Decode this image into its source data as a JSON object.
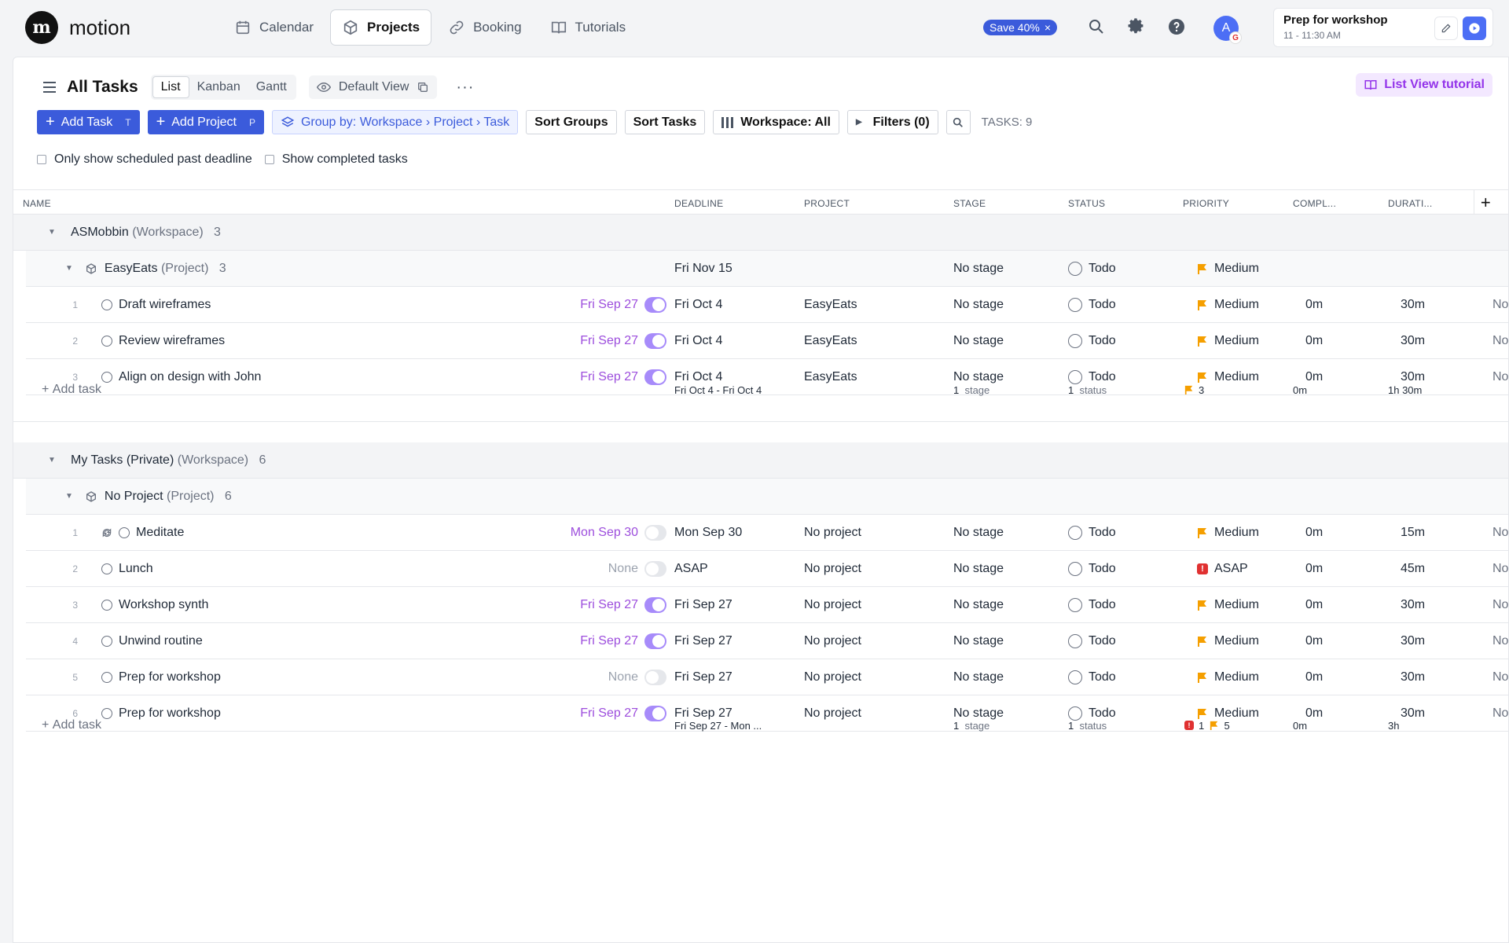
{
  "app": {
    "name": "motion",
    "logo_letter": "m"
  },
  "nav": {
    "items": [
      {
        "label": "Calendar",
        "icon": "calendar-icon"
      },
      {
        "label": "Projects",
        "icon": "cube-icon"
      },
      {
        "label": "Booking",
        "icon": "link-icon"
      },
      {
        "label": "Tutorials",
        "icon": "book-icon"
      }
    ],
    "active": "Projects"
  },
  "promo": {
    "label": "Save 40%",
    "close": "×"
  },
  "user": {
    "initial": "A",
    "badge": "G"
  },
  "event": {
    "title": "Prep for workshop",
    "time": "11 - 11:30 AM"
  },
  "page": {
    "title": "All Tasks",
    "views": [
      "List",
      "Kanban",
      "Gantt"
    ],
    "active_view": "List",
    "default_view": "Default View",
    "more": "···",
    "tutorial": "List View tutorial"
  },
  "toolbar": {
    "add_task": "Add Task",
    "add_task_key": "T",
    "add_project": "Add Project",
    "add_project_key": "P",
    "group_by": "Group by: Workspace › Project › Task",
    "sort_groups": "Sort Groups",
    "sort_tasks": "Sort Tasks",
    "workspace": "Workspace: All",
    "filters": "Filters (0)",
    "task_count": "TASKS: 9"
  },
  "options": {
    "past_deadline": "Only show scheduled past deadline",
    "show_completed": "Show completed tasks"
  },
  "columns": {
    "name": "NAME",
    "deadline": "DEADLINE",
    "project": "PROJECT",
    "stage": "STAGE",
    "status": "STATUS",
    "priority": "PRIORITY",
    "completed": "COMPL...",
    "duration": "DURATI...",
    "add": "+"
  },
  "groups": [
    {
      "workspace": "ASMobbin",
      "workspace_tag": "(Workspace)",
      "workspace_count": "3",
      "project": "EasyEats",
      "project_tag": "(Project)",
      "project_count": "3",
      "project_deadline": "Fri Nov 15",
      "project_stage": "No stage",
      "project_status": "Todo",
      "project_priority": "Medium",
      "tasks": [
        {
          "n": "1",
          "name": "Draft wireframes",
          "scheduled": "Fri Sep 27",
          "auto": true,
          "deadline": "Fri Oct 4",
          "project": "EasyEats",
          "stage": "No stage",
          "status": "Todo",
          "priority": "Medium",
          "completed": "0m",
          "duration": "30m",
          "extra": "No"
        },
        {
          "n": "2",
          "name": "Review wireframes",
          "scheduled": "Fri Sep 27",
          "auto": true,
          "deadline": "Fri Oct 4",
          "project": "EasyEats",
          "stage": "No stage",
          "status": "Todo",
          "priority": "Medium",
          "completed": "0m",
          "duration": "30m",
          "extra": "No"
        },
        {
          "n": "3",
          "name": "Align on design with John",
          "scheduled": "Fri Sep 27",
          "auto": true,
          "deadline": "Fri Oct 4",
          "project": "EasyEats",
          "stage": "No stage",
          "status": "Todo",
          "priority": "Medium",
          "completed": "0m",
          "duration": "30m",
          "extra": "No"
        }
      ],
      "summary": {
        "add": "Add task",
        "deadline": "Fri Oct 4 - Fri Oct 4",
        "stage_n": "1",
        "stage": "stage",
        "status_n": "1",
        "status": "status",
        "asap": "",
        "medium": "3",
        "completed": "0m",
        "duration": "1h 30m"
      }
    },
    {
      "workspace": "My Tasks (Private)",
      "workspace_tag": "(Workspace)",
      "workspace_count": "6",
      "project": "No Project",
      "project_tag": "(Project)",
      "project_count": "6",
      "tasks": [
        {
          "n": "1",
          "name": "Meditate",
          "recurring": true,
          "scheduled": "Mon Sep 30",
          "auto": false,
          "deadline": "Mon Sep 30",
          "project": "No project",
          "stage": "No stage",
          "status": "Todo",
          "priority": "Medium",
          "completed": "0m",
          "duration": "15m",
          "extra": "No"
        },
        {
          "n": "2",
          "name": "Lunch",
          "scheduled": "None",
          "auto": false,
          "deadline": "ASAP",
          "project": "No project",
          "stage": "No stage",
          "status": "Todo",
          "priority": "ASAP",
          "completed": "0m",
          "duration": "45m",
          "extra": "No"
        },
        {
          "n": "3",
          "name": "Workshop synth",
          "scheduled": "Fri Sep 27",
          "auto": true,
          "deadline": "Fri Sep 27",
          "project": "No project",
          "stage": "No stage",
          "status": "Todo",
          "priority": "Medium",
          "completed": "0m",
          "duration": "30m",
          "extra": "No"
        },
        {
          "n": "4",
          "name": "Unwind routine",
          "scheduled": "Fri Sep 27",
          "auto": true,
          "deadline": "Fri Sep 27",
          "project": "No project",
          "stage": "No stage",
          "status": "Todo",
          "priority": "Medium",
          "completed": "0m",
          "duration": "30m",
          "extra": "No"
        },
        {
          "n": "5",
          "name": "Prep for workshop",
          "scheduled": "None",
          "auto": false,
          "deadline": "Fri Sep 27",
          "project": "No project",
          "stage": "No stage",
          "status": "Todo",
          "priority": "Medium",
          "completed": "0m",
          "duration": "30m",
          "extra": "No"
        },
        {
          "n": "6",
          "name": "Prep for workshop",
          "scheduled": "Fri Sep 27",
          "auto": true,
          "deadline": "Fri Sep 27",
          "project": "No project",
          "stage": "No stage",
          "status": "Todo",
          "priority": "Medium",
          "completed": "0m",
          "duration": "30m",
          "extra": "No"
        }
      ],
      "summary": {
        "add": "Add task",
        "deadline": "Fri Sep 27 - Mon ...",
        "stage_n": "1",
        "stage": "stage",
        "status_n": "1",
        "status": "status",
        "asap": "1",
        "medium": "5",
        "completed": "0m",
        "duration": "3h"
      }
    }
  ],
  "colors": {
    "accent": "#3b5bdb",
    "scheduled": "#9d4edd",
    "flag_medium": "#f59f00",
    "flag_asap": "#e03131"
  }
}
